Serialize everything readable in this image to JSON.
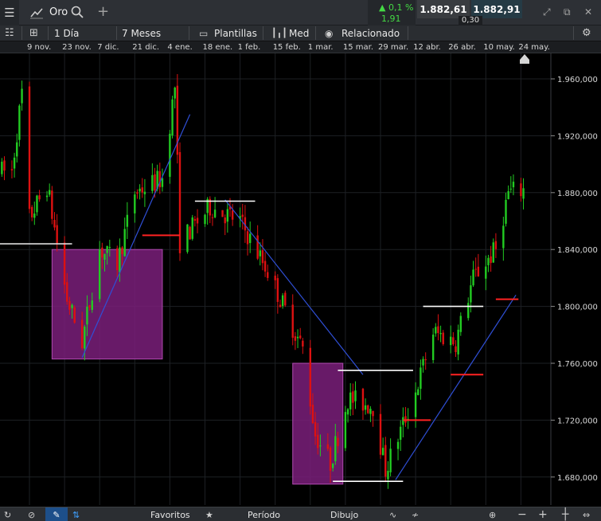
{
  "header": {
    "instrument": "Oro",
    "change_pct": "▲ 0,1 %",
    "change_pts": "1,91 pts",
    "bid": "1.882,61",
    "ask": "1.882,91",
    "spread": "0,30",
    "icons": [
      "menu-icon",
      "chart-line-icon",
      "search-icon",
      "add-tab-icon",
      "expand-icon",
      "maximize-icon",
      "popout-icon",
      "close-icon"
    ]
  },
  "toolbar": {
    "interval": "1 Día",
    "range": "7 Meses",
    "templates": "Plantillas",
    "chart_type": "Med",
    "related": "Relacionado"
  },
  "date_axis": [
    "9 nov.",
    "23 nov.",
    "7 dic.",
    "21 dic.",
    "4 ene.",
    "18 ene.",
    "1 feb.",
    "15 feb.",
    "1 mar.",
    "15 mar.",
    "29 mar.",
    "12 abr.",
    "26 abr.",
    "10 may.",
    "24 may."
  ],
  "bottom": {
    "favorites": "Favoritos",
    "period": "Período",
    "drawing": "Dibujo"
  },
  "colors": {
    "up": "#22cc22",
    "down": "#dd1111",
    "zone": "#7a1f7a",
    "trendline": "#2f4fd6",
    "support": "#ffffff",
    "signal": "#ff2222"
  },
  "chart_data": {
    "type": "candlestick",
    "title": "",
    "xlabel": "",
    "ylabel": "",
    "ylim": [
      1660,
      1970
    ],
    "y_ticks": [
      "1.960,000",
      "1.920,000",
      "1.880,000",
      "1.840,000",
      "1.800,000",
      "1.760,000",
      "1.720,000",
      "1.680,000"
    ],
    "last_price": 1882.61,
    "anchors": [
      [
        "2020-11-02",
        1895
      ],
      [
        "2020-11-06",
        1950
      ],
      [
        "2020-11-09",
        1862
      ],
      [
        "2020-11-16",
        1885
      ],
      [
        "2020-11-24",
        1805
      ],
      [
        "2020-11-30",
        1775
      ],
      [
        "2020-12-07",
        1840
      ],
      [
        "2020-12-14",
        1830
      ],
      [
        "2020-12-21",
        1880
      ],
      [
        "2021-01-01",
        1890
      ],
      [
        "2021-01-06",
        1955
      ],
      [
        "2021-01-08",
        1845
      ],
      [
        "2021-01-20",
        1870
      ],
      [
        "2021-02-01",
        1860
      ],
      [
        "2021-02-12",
        1825
      ],
      [
        "2021-02-26",
        1770
      ],
      [
        "2021-03-03",
        1710
      ],
      [
        "2021-03-09",
        1690
      ],
      [
        "2021-03-16",
        1735
      ],
      [
        "2021-03-26",
        1730
      ],
      [
        "2021-03-31",
        1685
      ],
      [
        "2021-04-12",
        1740
      ],
      [
        "2021-04-19",
        1782
      ],
      [
        "2021-04-28",
        1775
      ],
      [
        "2021-05-05",
        1820
      ],
      [
        "2021-05-14",
        1840
      ],
      [
        "2021-05-19",
        1880
      ],
      [
        "2021-05-25",
        1882
      ]
    ],
    "zones": [
      {
        "from": "2020-11-18",
        "to": "2021-01-01",
        "low": 1763,
        "high": 1840
      },
      {
        "from": "2021-02-22",
        "to": "2021-03-14",
        "low": 1675,
        "high": 1760
      }
    ],
    "trendlines": [
      {
        "from": [
          "2020-11-30",
          1764
        ],
        "to": [
          "2021-01-12",
          1935
        ]
      },
      {
        "from": [
          "2021-01-26",
          1875
        ],
        "to": [
          "2021-03-22",
          1752
        ]
      },
      {
        "from": [
          "2021-04-04",
          1678
        ],
        "to": [
          "2021-05-22",
          1808
        ]
      }
    ],
    "levels": [
      {
        "from": "2020-10-25",
        "to": "2020-11-26",
        "price": 1844,
        "color": "#dddddd"
      },
      {
        "from": "2021-01-14",
        "to": "2021-02-07",
        "price": 1874,
        "color": "#ffffff"
      },
      {
        "from": "2021-03-10",
        "to": "2021-04-07",
        "price": 1677,
        "color": "#ffffff"
      },
      {
        "from": "2021-03-12",
        "to": "2021-04-11",
        "price": 1755,
        "color": "#ffffff"
      },
      {
        "from": "2021-04-15",
        "to": "2021-05-09",
        "price": 1800,
        "color": "#ffffff"
      },
      {
        "from": "2020-12-24",
        "to": "2021-01-08",
        "price": 1850,
        "color": "#ff2222"
      },
      {
        "from": "2021-04-07",
        "to": "2021-04-18",
        "price": 1720,
        "color": "#ff2222"
      },
      {
        "from": "2021-04-26",
        "to": "2021-05-09",
        "price": 1752,
        "color": "#ff2222"
      },
      {
        "from": "2021-05-14",
        "to": "2021-05-23",
        "price": 1805,
        "color": "#ff2222"
      }
    ]
  }
}
